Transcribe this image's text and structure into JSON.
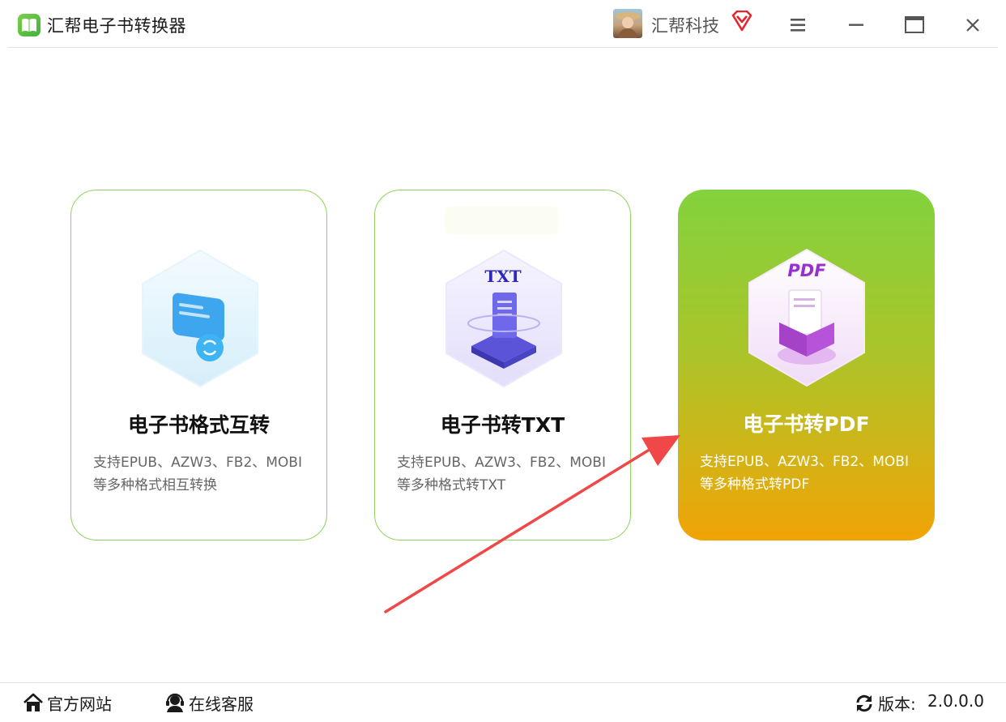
{
  "app": {
    "title": "汇帮电子书转换器"
  },
  "user": {
    "name": "汇帮科技"
  },
  "cards": [
    {
      "title": "电子书格式互转",
      "desc_line1": "支持EPUB、AZW3、FB2、MOBI",
      "desc_line2": "等多种格式相互转换"
    },
    {
      "title": "电子书转TXT",
      "badge": "TXT",
      "desc_line1": "支持EPUB、AZW3、FB2、MOBI",
      "desc_line2": "等多种格式转TXT"
    },
    {
      "title": "电子书转PDF",
      "badge": "PDF",
      "desc_line1": "支持EPUB、AZW3、FB2、MOBI",
      "desc_line2": "等多种格式转PDF"
    }
  ],
  "footer": {
    "official_site": "官方网站",
    "online_support": "在线客服",
    "version_label": "版本:",
    "version_number": "2.0.0.0"
  },
  "colors": {
    "brand_green": "#7bd04a",
    "card_border": "#8fd35c",
    "highlight_gradient_top": "#82d23e",
    "highlight_gradient_bottom": "#f1a306",
    "arrow_red": "#f04848"
  }
}
